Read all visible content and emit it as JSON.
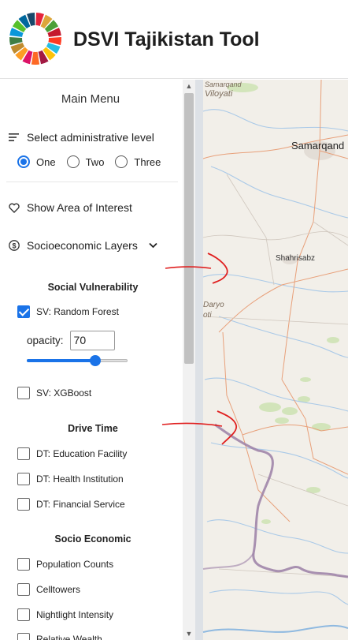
{
  "app": {
    "title": "DSVI Tajikistan Tool"
  },
  "menu": {
    "title": "Main Menu",
    "admin_level": {
      "label": "Select administrative level",
      "options": [
        "One",
        "Two",
        "Three"
      ],
      "selected": "One"
    },
    "area_of_interest": {
      "label": "Show Area of Interest"
    },
    "socioeconomic": {
      "label": "Socioeconomic Layers"
    }
  },
  "sections": {
    "social_vulnerability": {
      "title": "Social Vulnerability",
      "items": [
        {
          "label": "SV: Random Forest",
          "checked": true
        },
        {
          "label": "SV: XGBoost",
          "checked": false
        }
      ],
      "opacity": {
        "label": "opacity:",
        "value": "70",
        "level": 70
      }
    },
    "drive_time": {
      "title": "Drive Time",
      "items": [
        {
          "label": "DT: Education Facility",
          "checked": false
        },
        {
          "label": "DT: Health Institution",
          "checked": false
        },
        {
          "label": "DT: Financial Service",
          "checked": false
        }
      ]
    },
    "socio_economic": {
      "title": "Socio Economic",
      "items": [
        {
          "label": "Population Counts",
          "checked": false
        },
        {
          "label": "Celltowers",
          "checked": false
        },
        {
          "label": "Nightlight Intensity",
          "checked": false
        },
        {
          "label": "Relative Wealth",
          "checked": false
        }
      ]
    }
  },
  "map": {
    "labels": {
      "viloyati": "Viloyati",
      "samarqand": "Samarqand",
      "shahrisabz": "Shahrisabz",
      "daryo": "Daryo",
      "oti": "oti",
      "top_partial": "Samarqand"
    }
  },
  "colors": {
    "accent": "#1a73e8",
    "annotation": "#e02020",
    "border": "#9b7fa6",
    "river": "#a9c9e8",
    "road": "#e8a07a"
  }
}
